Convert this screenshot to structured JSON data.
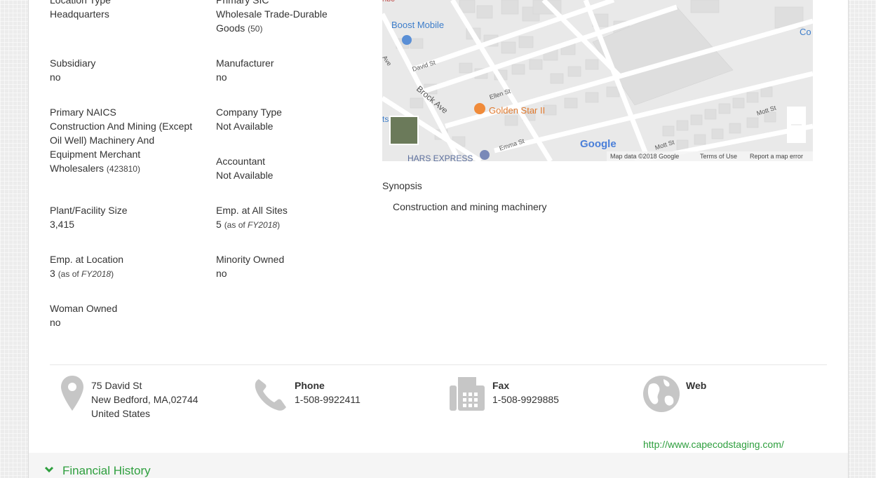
{
  "fields": {
    "location_type": {
      "label": "Location Type",
      "value": "Headquarters"
    },
    "primary_sic": {
      "label": "Primary SIC",
      "value_line1": "Wholesale Trade-Durable",
      "value_line2": "Goods",
      "code": "(50)"
    },
    "subsidiary": {
      "label": "Subsidiary",
      "value": "no"
    },
    "manufacturer": {
      "label": "Manufacturer",
      "value": "no"
    },
    "primary_naics": {
      "label": "Primary NAICS",
      "line1": "Construction And Mining (Except",
      "line2": "Oil Well) Machinery And",
      "line3": "Equipment Merchant",
      "line4": "Wholesalers",
      "code": "(423810)"
    },
    "company_type": {
      "label": "Company Type",
      "value": "Not Available"
    },
    "accountant": {
      "label": "Accountant",
      "value": "Not Available"
    },
    "plant_size": {
      "label": "Plant/Facility Size",
      "value": "3,415"
    },
    "emp_all_sites": {
      "label": "Emp. at All Sites",
      "value": "5",
      "as_of": "(as of",
      "fy": "FY2018",
      "close": ")"
    },
    "emp_location": {
      "label": "Emp. at Location",
      "value": "3",
      "as_of": "(as of",
      "fy": "FY2018",
      "close": ")"
    },
    "minority_owned": {
      "label": "Minority Owned",
      "value": "no"
    },
    "woman_owned": {
      "label": "Woman Owned",
      "value": "no"
    }
  },
  "map": {
    "labels": {
      "boost_mobile": "Boost Mobile",
      "golden_star": "Golden Star II",
      "david_st": "David St",
      "ellen_st": "Ellen St",
      "brock_ave": "Brock Ave",
      "emma_st": "Emma St",
      "mott_st": "Mott St",
      "mott_st2": "Mott St",
      "ave": "Ave",
      "hars": "HARS EXPRESS",
      "co": "Co",
      "ts": "ts",
      "nbc": "nbc"
    },
    "google": "Google",
    "map_data": "Map data ©2018 Google",
    "terms": "Terms of Use",
    "report": "Report a map error"
  },
  "synopsis": {
    "label": "Synopsis",
    "text": "Construction and mining machinery"
  },
  "contact": {
    "address": {
      "line1": "75 David St",
      "line2": "New Bedford, MA,02744",
      "line3": "United States",
      "icon": "location-pin-icon"
    },
    "phone": {
      "title": "Phone",
      "value": "1-508-9922411",
      "icon": "phone-icon"
    },
    "fax": {
      "title": "Fax",
      "value": "1-508-9929885",
      "icon": "fax-icon"
    },
    "web": {
      "title": "Web",
      "url": "http://www.capecodstaging.com/",
      "icon": "globe-icon"
    }
  },
  "financial_history": {
    "label": "Financial History",
    "icon": "chevron-down-icon"
  },
  "colors": {
    "accent": "#2e9f3e",
    "icon_gray": "#c6c6c6"
  }
}
